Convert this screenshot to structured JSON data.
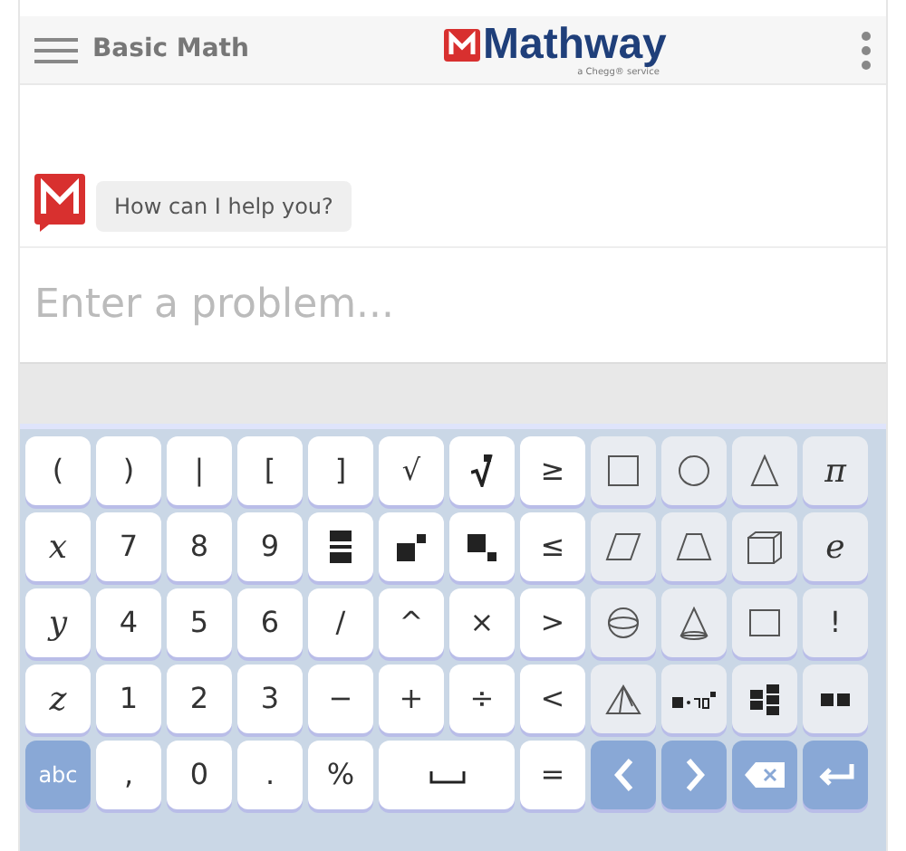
{
  "header": {
    "subject": "Basic Math",
    "logo": "Mathway",
    "tagline": "a Chegg® service"
  },
  "chat": [
    {
      "text": "How can I help you?"
    }
  ],
  "input": {
    "placeholder": "Enter a problem..."
  },
  "keyboard": [
    [
      {
        "kind": "text",
        "label": "("
      },
      {
        "kind": "text",
        "label": ")"
      },
      {
        "kind": "text",
        "label": "|"
      },
      {
        "kind": "text",
        "label": "["
      },
      {
        "kind": "text",
        "label": "]"
      },
      {
        "kind": "text",
        "label": "√"
      },
      {
        "kind": "icon"
      },
      {
        "kind": "text",
        "label": "≥"
      },
      {
        "kind": "icon"
      },
      {
        "kind": "icon"
      },
      {
        "kind": "icon"
      },
      {
        "kind": "math",
        "label": "π"
      }
    ],
    [
      {
        "kind": "math",
        "label": "x"
      },
      {
        "kind": "text",
        "label": "7"
      },
      {
        "kind": "text",
        "label": "8"
      },
      {
        "kind": "text",
        "label": "9"
      },
      {
        "kind": "icon"
      },
      {
        "kind": "icon"
      },
      {
        "kind": "icon"
      },
      {
        "kind": "text",
        "label": "≤"
      },
      {
        "kind": "icon"
      },
      {
        "kind": "icon"
      },
      {
        "kind": "icon"
      },
      {
        "kind": "math",
        "label": "e"
      }
    ],
    [
      {
        "kind": "math",
        "label": "y"
      },
      {
        "kind": "text",
        "label": "4"
      },
      {
        "kind": "text",
        "label": "5"
      },
      {
        "kind": "text",
        "label": "6"
      },
      {
        "kind": "text",
        "label": "/"
      },
      {
        "kind": "text",
        "label": "^"
      },
      {
        "kind": "text",
        "label": "×"
      },
      {
        "kind": "text",
        "label": ">"
      },
      {
        "kind": "icon"
      },
      {
        "kind": "icon"
      },
      {
        "kind": "icon"
      },
      {
        "kind": "text",
        "label": "!"
      }
    ],
    [
      {
        "kind": "math",
        "label": "z"
      },
      {
        "kind": "text",
        "label": "1"
      },
      {
        "kind": "text",
        "label": "2"
      },
      {
        "kind": "text",
        "label": "3"
      },
      {
        "kind": "text",
        "label": "−"
      },
      {
        "kind": "text",
        "label": "+"
      },
      {
        "kind": "text",
        "label": "÷"
      },
      {
        "kind": "text",
        "label": "<"
      },
      {
        "kind": "icon"
      },
      {
        "kind": "icon"
      },
      {
        "kind": "icon"
      },
      {
        "kind": "icon"
      }
    ],
    [
      {
        "kind": "text",
        "label": "abc"
      },
      {
        "kind": "text",
        "label": ","
      },
      {
        "kind": "text",
        "label": "0"
      },
      {
        "kind": "text",
        "label": "."
      },
      {
        "kind": "text",
        "label": "%"
      },
      {
        "kind": "icon"
      },
      {
        "kind": "text",
        "label": "="
      },
      {
        "kind": "icon"
      },
      {
        "kind": "icon"
      },
      {
        "kind": "icon"
      },
      {
        "kind": "icon"
      }
    ]
  ]
}
